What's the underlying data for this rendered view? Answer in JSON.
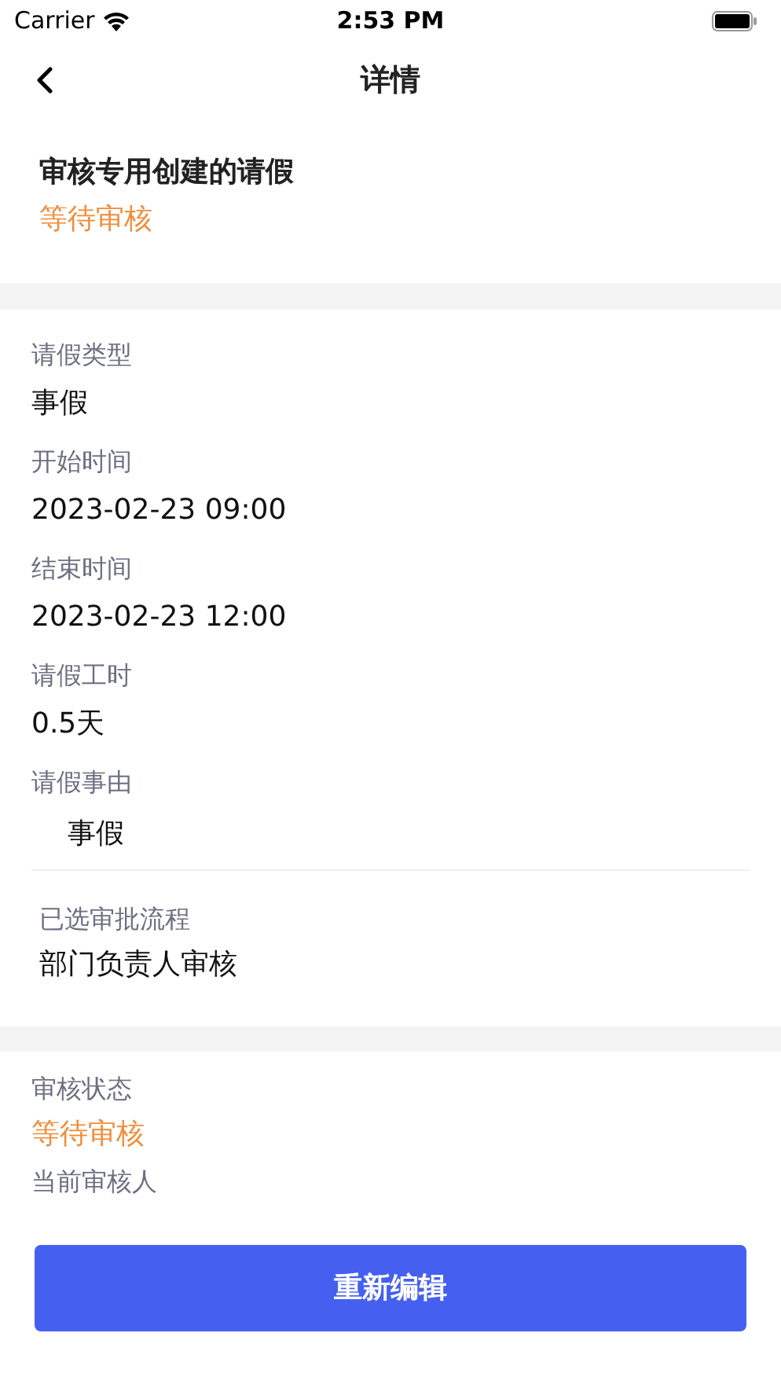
{
  "status_bar": {
    "carrier": "Carrier",
    "time": "2:53 PM"
  },
  "nav": {
    "title": "详情"
  },
  "header": {
    "title": "审核专用创建的请假",
    "status": "等待审核"
  },
  "fields": [
    {
      "kind": "field",
      "label": "请假类型",
      "value": "事假"
    },
    {
      "kind": "field",
      "label": "开始时间",
      "value": "2023-02-23 09:00"
    },
    {
      "kind": "field",
      "label": "结束时间",
      "value": "2023-02-23 12:00"
    },
    {
      "kind": "field",
      "label": "请假工时",
      "value": "0.5天"
    },
    {
      "kind": "note",
      "label": "请假事由",
      "value": "事假"
    }
  ],
  "process": {
    "label": "已选审批流程",
    "value": "部门负责人审核"
  },
  "audit": {
    "label": "审核状态",
    "status": "等待审核",
    "reviewer_label": "当前审核人"
  },
  "button": {
    "label": "重新编辑"
  }
}
